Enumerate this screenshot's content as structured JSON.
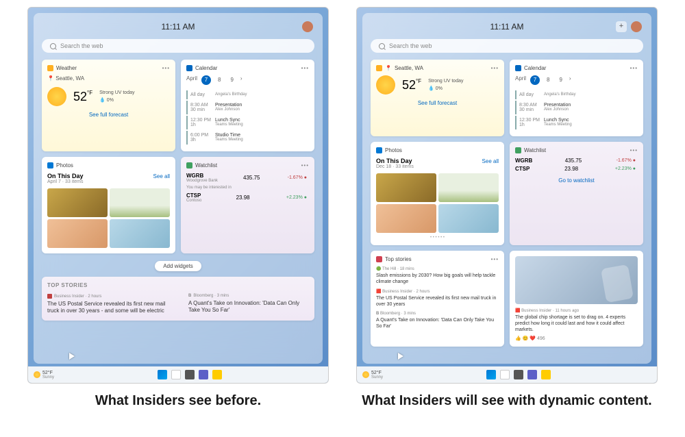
{
  "time": "11:11 AM",
  "search_placeholder": "Search the web",
  "weather": {
    "title": "Weather",
    "location": "Seattle, WA",
    "temp": "52",
    "unit": "°F",
    "cond": "Strong UV today",
    "precip": "0%",
    "link": "See full forecast"
  },
  "calendar": {
    "title": "Calendar",
    "month": "April",
    "dates": [
      "7",
      "8",
      "9"
    ],
    "events": [
      {
        "time": "All day",
        "name": "Angela's Birthday",
        "sub": ""
      },
      {
        "time": "8:30 AM",
        "sub": "30 min",
        "name": "Presentation",
        "who": "Alex Johnson"
      },
      {
        "time": "12:30 PM",
        "sub": "1h",
        "name": "Lunch Sync",
        "who": "Teams Meeting"
      },
      {
        "time": "6:00 PM",
        "sub": "3h",
        "name": "Studio Time",
        "who": "Teams Meeting"
      }
    ]
  },
  "photos": {
    "title": "Photos",
    "heading": "On This Day",
    "date_a": "April 7 · 33 items",
    "date_b": "Dec 18 · 33 items",
    "seeall": "See all"
  },
  "watchlist": {
    "title": "Watchlist",
    "rows": [
      {
        "sym": "WGRB",
        "name": "Woodgrove Bank",
        "price": "435.75",
        "chg": "-1.67%",
        "dir": "neg"
      },
      {
        "sym": "CTSP",
        "name": "Contoso",
        "price": "23.98",
        "chg": "+2.23%",
        "dir": "pos"
      }
    ],
    "interest": "You may be interested in",
    "link": "Go to watchlist"
  },
  "add_widgets": "Add widgets",
  "top_stories": {
    "label": "TOP STORIES",
    "items": [
      {
        "src": "Business Insider · 2 hours",
        "hl": "The US Postal Service revealed its first new mail truck in over 30 years - and some will be electric"
      },
      {
        "src": "Bloomberg · 3 mins",
        "srcb": "B",
        "hl": "A Quant's Take on Innovation: 'Data Can Only Take You So Far'"
      }
    ]
  },
  "news_b": {
    "title": "Top stories",
    "items": [
      {
        "src": "The Hill · 18 mins",
        "hl": "Slash emissions by 2030? How big goals will help tackle climate change"
      },
      {
        "src": "Business Insider · 2 hours",
        "hl": "The US Postal Service revealed its first new mail truck in over 30 years"
      },
      {
        "src": "Bloomberg · 3 mins",
        "hl": "A Quant's Take on Innovation: 'Data Can Only Take You So Far'"
      }
    ],
    "feature": {
      "src": "Business Insider · 11 hours ago",
      "hl": "The global chip shortage is set to drag on. 4 experts predict how long it could last and how it could affect markets."
    },
    "react": "👍 😊 ❤️  496"
  },
  "taskbar": {
    "temp": "52°F",
    "cond": "Sunny"
  },
  "captions": {
    "before": "What Insiders see before.",
    "after": "What Insiders will see with dynamic content."
  }
}
